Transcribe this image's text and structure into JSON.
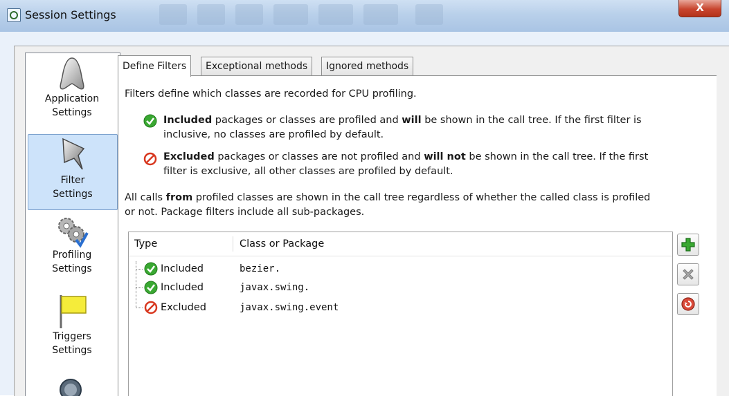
{
  "window": {
    "title": "Session Settings",
    "close_label": "X"
  },
  "nav": {
    "items": [
      {
        "label_line1": "Application",
        "label_line2": "Settings",
        "icon": "application-icon"
      },
      {
        "label_line1": "Filter",
        "label_line2": "Settings",
        "icon": "funnel-icon",
        "selected": true
      },
      {
        "label_line1": "Profiling",
        "label_line2": "Settings",
        "icon": "gears-icon"
      },
      {
        "label_line1": "Triggers",
        "label_line2": "Settings",
        "icon": "flag-icon"
      }
    ]
  },
  "tabs": [
    {
      "label": "Define Filters",
      "active": true
    },
    {
      "label": "Exceptional methods"
    },
    {
      "label": "Ignored methods"
    }
  ],
  "content": {
    "intro": "Filters define which classes are recorded for CPU profiling.",
    "included": {
      "bold1": "Included",
      "text1": " packages or classes are profiled and ",
      "bold2": "will",
      "text2": " be shown in the call tree. If the first filter is",
      "line2": "inclusive, no classes are profiled by default."
    },
    "excluded": {
      "bold1": "Excluded",
      "text1": " packages or classes are not profiled and ",
      "bold2": "will not",
      "text2": " be shown in the call tree. If the first",
      "line2": "filter is exclusive, all other classes are profiled by default."
    },
    "calls": {
      "text1": "All calls ",
      "bold1": "from",
      "text2": " profiled classes are shown in the call tree regardless of whether the called class is profiled",
      "line2": "or not. Package filters include all sub-packages."
    }
  },
  "table": {
    "headers": {
      "type": "Type",
      "class": "Class or Package"
    },
    "rows": [
      {
        "type": "Included",
        "class": "bezier.",
        "status": "included"
      },
      {
        "type": "Included",
        "class": "javax.swing.",
        "status": "included"
      },
      {
        "type": "Excluded",
        "class": "javax.swing.event",
        "status": "excluded"
      }
    ]
  },
  "buttons": {
    "add": "add-icon",
    "remove": "remove-icon",
    "reset": "reset-icon"
  },
  "colors": {
    "included_green": "#3aa832",
    "excluded_red": "#d8371f",
    "selection_bg": "#cde3fa",
    "add_green": "#2e9e2e"
  }
}
